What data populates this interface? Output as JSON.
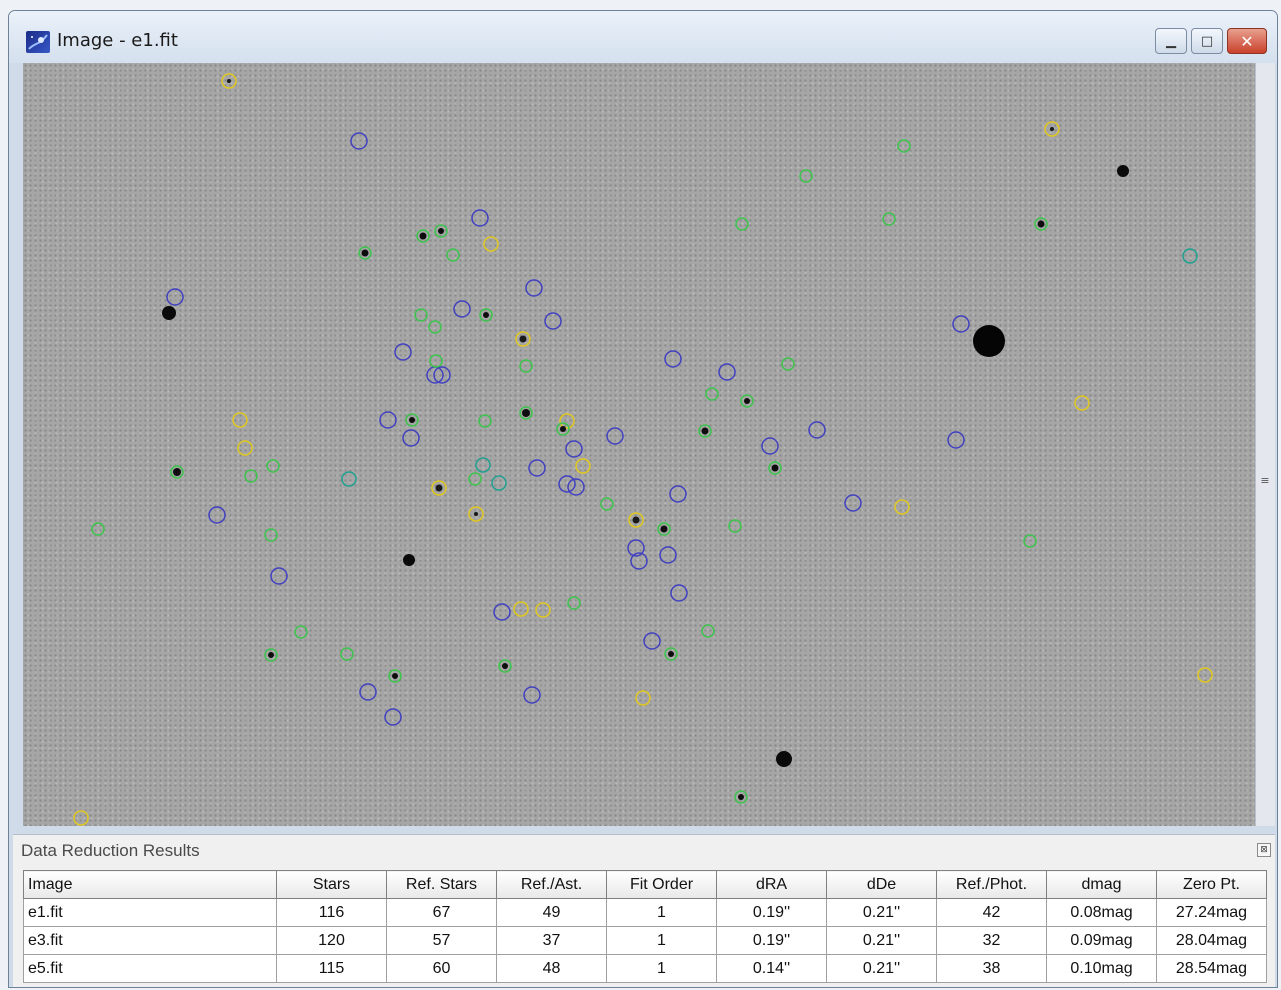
{
  "window": {
    "title": "Image - e1.fit",
    "icon": "nebula-icon"
  },
  "results_panel": {
    "title": "Data Reduction Results",
    "columns": [
      "Image",
      "Stars",
      "Ref. Stars",
      "Ref./Ast.",
      "Fit Order",
      "dRA",
      "dDe",
      "Ref./Phot.",
      "dmag",
      "Zero Pt."
    ],
    "rows": [
      [
        "e1.fit",
        "116",
        "67",
        "49",
        "1",
        "0.19''",
        "0.21''",
        "42",
        "0.08mag",
        "27.24mag"
      ],
      [
        "e3.fit",
        "120",
        "57",
        "37",
        "1",
        "0.19''",
        "0.21''",
        "32",
        "0.09mag",
        "28.04mag"
      ],
      [
        "e5.fit",
        "115",
        "60",
        "48",
        "1",
        "0.14''",
        "0.21''",
        "38",
        "0.10mag",
        "28.54mag"
      ]
    ]
  },
  "colors": {
    "marker_blue": "#4040c0",
    "marker_green": "#30c040",
    "marker_yellow": "#d8c020",
    "marker_teal": "#20a090",
    "sky_background": "#a6a6a6"
  }
}
